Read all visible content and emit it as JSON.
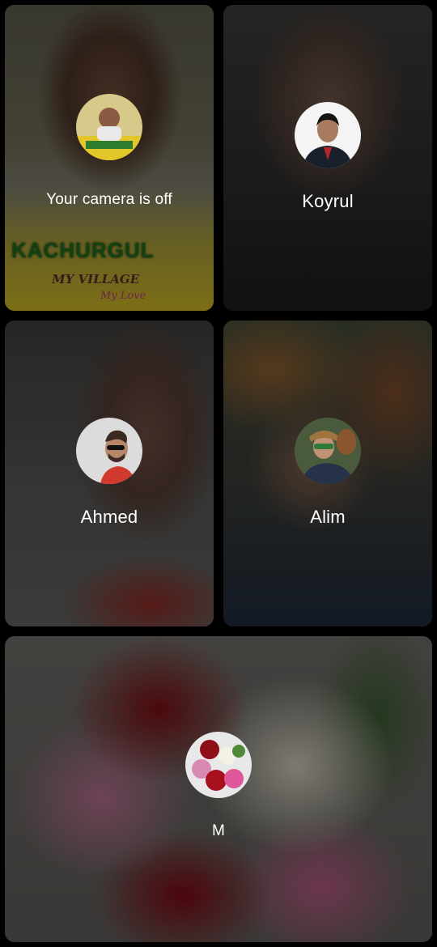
{
  "tiles": [
    {
      "id": "self",
      "label": "Your camera is off",
      "background": {
        "banner_main": "KACHURGUL",
        "banner_sub": "MY VILLAGE",
        "banner_tag": "My Love"
      }
    },
    {
      "id": "koyrul",
      "label": "Koyrul"
    },
    {
      "id": "ahmed",
      "label": "Ahmed"
    },
    {
      "id": "alim",
      "label": "Alim"
    },
    {
      "id": "m",
      "label": "M"
    }
  ],
  "colors": {
    "page_background": "#000000",
    "label_text": "#ffffff"
  }
}
